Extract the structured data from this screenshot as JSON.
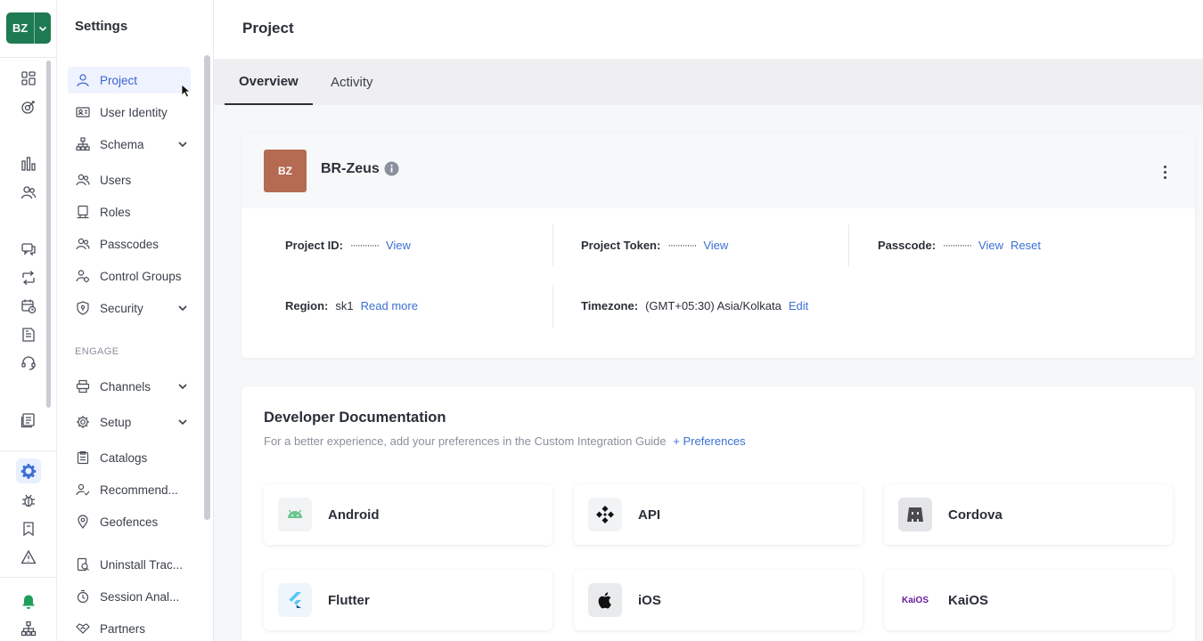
{
  "workspace": {
    "abbr": "BZ"
  },
  "rail": {
    "icons": [
      "dashboard-icon",
      "analytics-target-icon",
      "bar-chart-icon",
      "segments-icon",
      "messages-icon",
      "journeys-icon",
      "campaign-schedule-icon",
      "templates-icon",
      "support-headset-icon",
      "reports-icon",
      "settings-gear-icon",
      "debug-bug-icon",
      "docs-bookmark-icon",
      "alert-warning-icon",
      "notifications-bell-icon",
      "hierarchy-icon"
    ],
    "active": "settings-gear-icon",
    "accent_color": "#3b6fd4",
    "bell_color": "#1e9e5a"
  },
  "sidebar": {
    "title": "Settings",
    "items": [
      {
        "label": "Project",
        "icon": "user-icon",
        "active": true
      },
      {
        "label": "User Identity",
        "icon": "id-card-icon"
      },
      {
        "label": "Schema",
        "icon": "schema-tree-icon",
        "expandable": true
      },
      {
        "label": "Users",
        "icon": "users-icon"
      },
      {
        "label": "Roles",
        "icon": "roles-icon"
      },
      {
        "label": "Passcodes",
        "icon": "passcodes-icon"
      },
      {
        "label": "Control Groups",
        "icon": "control-groups-icon"
      },
      {
        "label": "Security",
        "icon": "shield-icon",
        "expandable": true
      }
    ],
    "section_engage": "ENGAGE",
    "engage_items": [
      {
        "label": "Channels",
        "icon": "channels-icon",
        "expandable": true
      },
      {
        "label": "Setup",
        "icon": "gear-icon",
        "expandable": true
      },
      {
        "label": "Catalogs",
        "icon": "catalog-icon"
      },
      {
        "label": "Recommend...",
        "icon": "recommend-icon"
      },
      {
        "label": "Geofences",
        "icon": "map-pin-icon"
      },
      {
        "label": "Uninstall Trac...",
        "icon": "uninstall-icon"
      },
      {
        "label": "Session Anal...",
        "icon": "session-icon"
      },
      {
        "label": "Partners",
        "icon": "handshake-icon"
      }
    ]
  },
  "page": {
    "title": "Project",
    "tabs": [
      {
        "label": "Overview",
        "active": true
      },
      {
        "label": "Activity"
      }
    ]
  },
  "project": {
    "avatar_abbr": "BZ",
    "avatar_color": "#b56a52",
    "name": "BR-Zeus",
    "id_label": "Project ID:",
    "masked": "············",
    "view": "View",
    "token_label": "Project Token:",
    "passcode_label": "Passcode:",
    "reset": "Reset",
    "region_label": "Region:",
    "region_value": "sk1",
    "read_more": "Read more",
    "timezone_label": "Timezone:",
    "timezone_value": "(GMT+05:30) Asia/Kolkata",
    "edit": "Edit"
  },
  "docs": {
    "title": "Developer Documentation",
    "subtitle": "For a better experience, add your preferences in the Custom Integration Guide",
    "preferences_link": "+ Preferences",
    "platforms": [
      {
        "name": "Android",
        "icon": "android-icon"
      },
      {
        "name": "API",
        "icon": "api-icon"
      },
      {
        "name": "Cordova",
        "icon": "cordova-icon"
      },
      {
        "name": "Flutter",
        "icon": "flutter-icon"
      },
      {
        "name": "iOS",
        "icon": "apple-icon"
      },
      {
        "name": "KaiOS",
        "icon": "kaios-icon",
        "logo_text": "KaiOS"
      }
    ]
  }
}
